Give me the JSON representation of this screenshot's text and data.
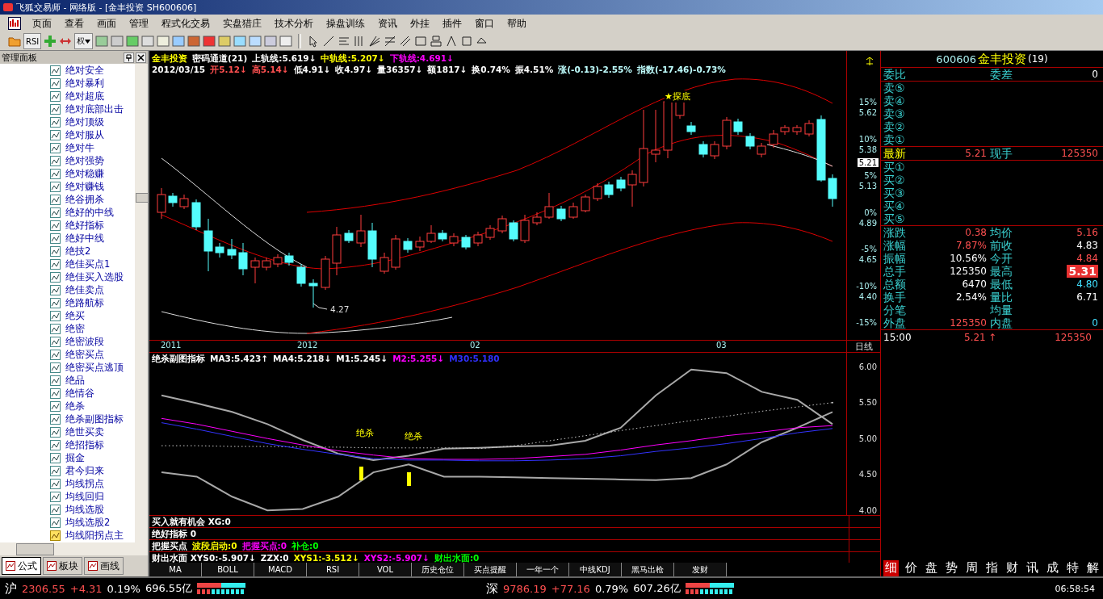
{
  "window": {
    "title": "飞狐交易师 - 网络版 - [金丰投资 SH600606]"
  },
  "menu": [
    "页面",
    "查看",
    "画面",
    "管理",
    "程式化交易",
    "实盘猎庄",
    "技术分析",
    "操盘训练",
    "资讯",
    "外挂",
    "插件",
    "窗口",
    "帮助"
  ],
  "toolbar": {
    "rsi_label": "RSI",
    "rights_label": "权"
  },
  "panel": {
    "title": "管理面板",
    "items": [
      {
        "label": "绝对安全",
        "kind": "formula"
      },
      {
        "label": "绝对暴利",
        "kind": "formula"
      },
      {
        "label": "绝对超底",
        "kind": "formula"
      },
      {
        "label": "绝对底部出击",
        "kind": "formula"
      },
      {
        "label": "绝对顶级",
        "kind": "formula"
      },
      {
        "label": "绝对服从",
        "kind": "formula"
      },
      {
        "label": "绝对牛",
        "kind": "formula"
      },
      {
        "label": "绝对强势",
        "kind": "formula"
      },
      {
        "label": "绝对稳赚",
        "kind": "formula"
      },
      {
        "label": "绝对赚钱",
        "kind": "formula"
      },
      {
        "label": "绝谷拥杀",
        "kind": "formula"
      },
      {
        "label": "绝好的中线",
        "kind": "formula"
      },
      {
        "label": "绝好指标",
        "kind": "formula"
      },
      {
        "label": "绝好中线",
        "kind": "formula"
      },
      {
        "label": "绝技2",
        "kind": "formula"
      },
      {
        "label": "绝佳买点1",
        "kind": "formula"
      },
      {
        "label": "绝佳买入选股",
        "kind": "formula"
      },
      {
        "label": "绝佳卖点",
        "kind": "formula"
      },
      {
        "label": "绝路航标",
        "kind": "formula"
      },
      {
        "label": "绝买",
        "kind": "formula"
      },
      {
        "label": "绝密",
        "kind": "formula"
      },
      {
        "label": "绝密波段",
        "kind": "formula"
      },
      {
        "label": "绝密买点",
        "kind": "formula"
      },
      {
        "label": "绝密买点逃顶",
        "kind": "formula"
      },
      {
        "label": "绝品",
        "kind": "formula"
      },
      {
        "label": "绝情谷",
        "kind": "formula"
      },
      {
        "label": "绝杀",
        "kind": "formula"
      },
      {
        "label": "绝杀副图指标",
        "kind": "formula"
      },
      {
        "label": "绝世买卖",
        "kind": "formula"
      },
      {
        "label": "绝招指标",
        "kind": "formula"
      },
      {
        "label": "掘金",
        "kind": "formula"
      },
      {
        "label": "君今归来",
        "kind": "formula"
      },
      {
        "label": "均线拐点",
        "kind": "formula"
      },
      {
        "label": "均线回归",
        "kind": "formula"
      },
      {
        "label": "均线选股",
        "kind": "formula"
      },
      {
        "label": "均线选股2",
        "kind": "formula"
      },
      {
        "label": "均线阳拐点主",
        "kind": "expert"
      }
    ],
    "tabs": [
      {
        "label": "公式",
        "selected": true
      },
      {
        "label": "板块",
        "selected": false
      },
      {
        "label": "画线",
        "selected": false
      }
    ]
  },
  "main_chart": {
    "header": [
      [
        {
          "text": "金丰投资",
          "color": "#ffff00"
        },
        {
          "text": "密码通道(21)",
          "color": "#ffffff"
        },
        {
          "text": "上轨线:5.619↓",
          "color": "#ffffff"
        },
        {
          "text": "中轨线:5.207↓",
          "color": "#ffff00"
        },
        {
          "text": "下轨线:4.691↓",
          "color": "#ff00ff"
        }
      ],
      [
        {
          "text": "2012/03/15",
          "color": "#ffffff"
        },
        {
          "text": "开5.12↓",
          "color": "#ff5050"
        },
        {
          "text": "高5.14↓",
          "color": "#ff5050"
        },
        {
          "text": "低4.91↓",
          "color": "#ffffff"
        },
        {
          "text": "收4.97↓",
          "color": "#ffffff"
        },
        {
          "text": "量36357↓",
          "color": "#ffffff"
        },
        {
          "text": "额1817↓",
          "color": "#ffffff"
        },
        {
          "text": "换0.74%",
          "color": "#ffffff"
        },
        {
          "text": "振4.51%",
          "color": "#ffffff"
        },
        {
          "text": "涨(-0.13)-2.55%",
          "color": "#c0ffff"
        },
        {
          "text": "指数(-17.46)-0.73%",
          "color": "#c0ffff"
        }
      ]
    ],
    "price_axis": [
      {
        "pct": "15%",
        "price": "5.62"
      },
      {
        "pct": "10%",
        "price": "5.38"
      },
      {
        "pct": "5%",
        "price": "5.13"
      },
      {
        "pct": "0%",
        "price": "4.89"
      },
      {
        "pct": "-5%",
        "price": "4.65"
      },
      {
        "pct": "-10%",
        "price": "4.40"
      },
      {
        "pct": "-15%"
      }
    ],
    "current_price": "5.21",
    "signal": "★探底",
    "low_label": "4.27",
    "dates": [
      "2011",
      "2012",
      "02",
      "03"
    ],
    "period": "日线"
  },
  "sub_chart": {
    "header": [
      {
        "text": "绝杀副图指标",
        "color": "#ffffff"
      },
      {
        "text": "MA3:5.423↑",
        "color": "#ffffff"
      },
      {
        "text": "MA4:5.218↓",
        "color": "#ffffff"
      },
      {
        "text": "M1:5.245↓",
        "color": "#ffffff"
      },
      {
        "text": "M2:5.255↓",
        "color": "#ff00ff"
      },
      {
        "text": "M30:5.180",
        "color": "#3030ff"
      }
    ],
    "signals": [
      "绝杀",
      "绝杀"
    ],
    "chart_data": {
      "type": "line",
      "ylim": [
        3.93,
        6.2
      ],
      "yticks": [
        {
          "value": 6,
          "label": "6.00"
        },
        {
          "value": 5.5,
          "label": "5.50"
        },
        {
          "value": 5,
          "label": "5.00"
        },
        {
          "value": 4.5,
          "label": "4.50"
        },
        {
          "value": 4,
          "label": "4.00"
        }
      ],
      "series": [
        {
          "color": "#a8a8a8",
          "values": [
            5.62,
            5.51,
            5.39,
            5.22,
            5.0,
            4.81,
            4.72,
            4.78,
            4.88,
            4.89,
            4.91,
            4.92,
            4.99,
            5.17,
            5.62,
            5.98,
            5.93,
            5.67,
            5.56,
            5.22
          ]
        },
        {
          "color": "#a8a8a8",
          "values": [
            4.55,
            4.49,
            4.21,
            4.02,
            4.04,
            4.21,
            4.55,
            4.66,
            4.49,
            4.49,
            4.48,
            4.47,
            4.46,
            4.45,
            4.44,
            4.47,
            4.66,
            4.97,
            5.17,
            5.39
          ]
        },
        {
          "color": "#c8c8c8",
          "line_style": "dotted",
          "values": [
            4.92,
            4.92,
            4.91,
            4.91,
            4.9,
            4.9,
            4.89,
            4.89,
            4.89,
            4.88,
            4.92,
            4.99,
            5.06,
            5.13,
            5.2,
            5.27,
            5.33,
            5.4,
            5.46,
            5.52
          ]
        },
        {
          "color": "#ff00ff",
          "values": [
            5.3,
            5.22,
            5.12,
            5.02,
            4.93,
            4.85,
            4.79,
            4.74,
            4.73,
            4.73,
            4.74,
            4.77,
            4.8,
            4.86,
            4.93,
            4.99,
            5.06,
            5.11,
            5.17,
            5.2
          ]
        },
        {
          "color": "#3333ff",
          "values": [
            5.24,
            5.15,
            5.05,
            4.95,
            4.87,
            4.8,
            4.74,
            4.72,
            4.72,
            4.71,
            4.71,
            4.72,
            4.74,
            4.78,
            4.84,
            4.89,
            4.95,
            5.02,
            5.1,
            5.16
          ]
        }
      ]
    }
  },
  "indicator_lines": [
    [
      {
        "text": "买入就有机会 XG:0",
        "color": "#ffffff"
      }
    ],
    [
      {
        "text": "绝好指标 0",
        "color": "#ffffff"
      }
    ],
    [
      {
        "text": "把握买点",
        "color": "#ffffff"
      },
      {
        "text": "波段启动:0",
        "color": "#ffff00"
      },
      {
        "text": "把握买点:0",
        "color": "#ff00ff"
      },
      {
        "text": "补仓:0",
        "color": "#00ff00"
      }
    ],
    [
      {
        "text": "财出水面 XYS0:-5.907↓",
        "color": "#ffffff"
      },
      {
        "text": "ZZX:0",
        "color": "#ffffff"
      },
      {
        "text": "XYS1:-3.512↓",
        "color": "#ffff00"
      },
      {
        "text": "XYS2:-5.907↓",
        "color": "#ff00ff"
      },
      {
        "text": "财出水面:0",
        "color": "#00ff00"
      }
    ]
  ],
  "indicator_tabs": [
    "MA",
    "BOLL",
    "MACD",
    "RSI",
    "VOL",
    "历史仓位",
    "买点提醒",
    "一年一个",
    "中线KDJ",
    "黑马出枪",
    "发财"
  ],
  "quote": {
    "code": "600606",
    "name": "金丰投资",
    "count": "(19)",
    "ratio": {
      "label": "委比",
      "diff_label": "委差",
      "diff": "0"
    },
    "asks": [
      "卖⑤",
      "卖④",
      "卖③",
      "卖②",
      "卖①"
    ],
    "latest": {
      "label": "最新",
      "price": "5.21",
      "vol_label": "现手",
      "volume": "125350"
    },
    "bids": [
      "买①",
      "买②",
      "买③",
      "买④",
      "买⑤"
    ],
    "stats": [
      {
        "label": "涨跌",
        "value": "0.38",
        "color": "#ff5050",
        "highlight": false
      },
      {
        "label": "均价",
        "value": "5.16",
        "color": "#ff5050",
        "highlight": false
      },
      {
        "label": "涨幅",
        "value": "7.87%",
        "color": "#ff5050",
        "highlight": false
      },
      {
        "label": "前收",
        "value": "4.83",
        "color": "#ffffff",
        "highlight": false
      },
      {
        "label": "振幅",
        "value": "10.56%",
        "color": "#ffffff",
        "highlight": false
      },
      {
        "label": "今开",
        "value": "4.84",
        "color": "#ff5050",
        "highlight": false
      },
      {
        "label": "总手",
        "value": "125350",
        "color": "#ffffff",
        "highlight": false
      },
      {
        "label": "最高",
        "value": "5.31",
        "color": "#e83030",
        "highlight": true
      },
      {
        "label": "总额",
        "value": "6470",
        "color": "#ffffff",
        "highlight": false
      },
      {
        "label": "最低",
        "value": "4.80",
        "color": "#40e0ff",
        "highlight": false
      },
      {
        "label": "换手",
        "value": "2.54%",
        "color": "#ffffff",
        "highlight": false
      },
      {
        "label": "量比",
        "value": "6.71",
        "color": "#ffffff",
        "highlight": false
      },
      {
        "label": "分笔"
      },
      {
        "label": "均量"
      },
      {
        "label": "外盘",
        "value": "125350",
        "color": "#ff5050",
        "highlight": false
      },
      {
        "label": "内盘",
        "value": "0",
        "color": "#40e0ff",
        "highlight": false
      }
    ],
    "tick": {
      "time": "15:00",
      "price": "5.21",
      "arrow": "↑",
      "volume": "125350"
    }
  },
  "quote_tabs": [
    {
      "label": "细",
      "selected": true
    },
    {
      "label": "价",
      "selected": false
    },
    {
      "label": "盘",
      "selected": false
    },
    {
      "label": "势",
      "selected": false
    },
    {
      "label": "周",
      "selected": false
    },
    {
      "label": "指",
      "selected": false
    },
    {
      "label": "财",
      "selected": false
    },
    {
      "label": "讯",
      "selected": false
    },
    {
      "label": "成",
      "selected": false
    },
    {
      "label": "特",
      "selected": false
    },
    {
      "label": "解",
      "selected": false
    }
  ],
  "status": {
    "markets": [
      {
        "market": "沪",
        "index": "2306.55",
        "change": "+4.31",
        "pct": "0.19%",
        "amount": "696.55亿"
      },
      {
        "market": "深",
        "index": "9786.19",
        "change": "+77.16",
        "pct": "0.79%",
        "amount": "607.26亿"
      }
    ],
    "time": "06:58:54"
  }
}
